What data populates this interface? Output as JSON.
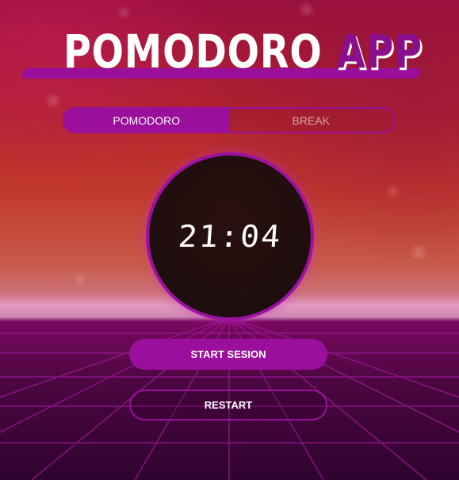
{
  "header": {
    "title_main": "POMODORO",
    "title_accent": "APP"
  },
  "mode_toggle": {
    "options": [
      {
        "label": "POMODORO",
        "active": true
      },
      {
        "label": "BREAK",
        "active": false
      }
    ]
  },
  "timer": {
    "display": "21:04"
  },
  "actions": {
    "start_label": "START SESION",
    "restart_label": "RESTART"
  },
  "theme": {
    "accent": "#9a0f9c",
    "timer_background": "#1e0d0d"
  }
}
